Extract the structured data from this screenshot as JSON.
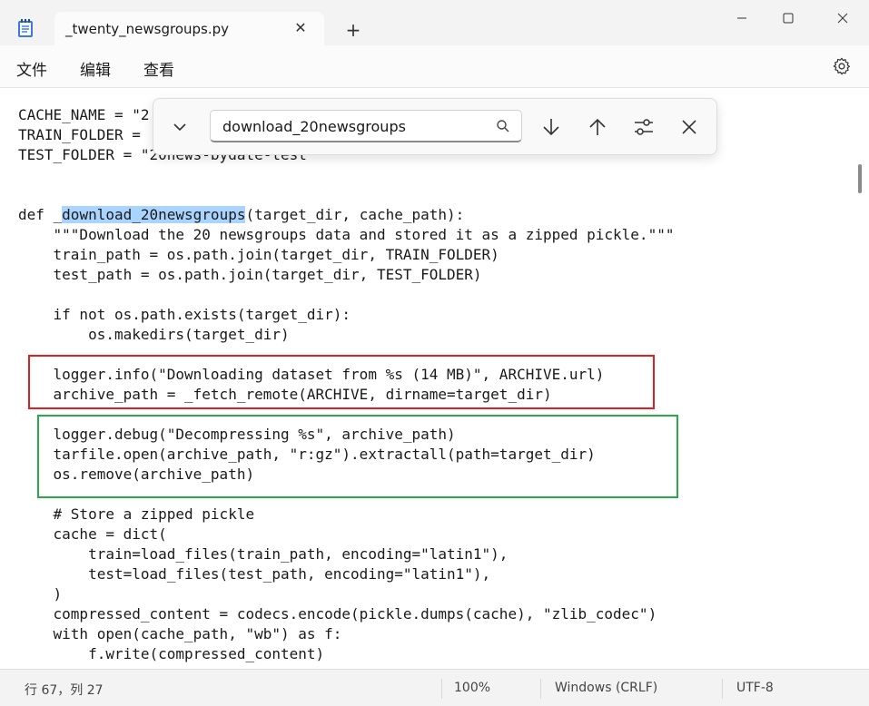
{
  "window": {
    "tab_title": "_twenty_newsgroups.py",
    "tab_close": "✕",
    "new_tab": "+",
    "minimize": "—",
    "maximize": "☐",
    "close": "✕"
  },
  "menu": {
    "items": [
      "文件",
      "编辑",
      "查看"
    ],
    "settings_icon": "gear-icon"
  },
  "find": {
    "query": "download_20newsgroups",
    "icons": [
      "chevron-down-icon",
      "search-icon",
      "arrow-down-icon",
      "arrow-up-icon",
      "options-icon",
      "close-icon"
    ]
  },
  "code": {
    "lines": [
      "CACHE_NAME = \"2",
      "TRAIN_FOLDER = ",
      "TEST_FOLDER = \"20news-bydate-test\"",
      "",
      "",
      "def _",
      "    \"\"\"Download the 20 newsgroups data and stored it as a zipped pickle.\"\"\"",
      "    train_path = os.path.join(target_dir, TRAIN_FOLDER)",
      "    test_path = os.path.join(target_dir, TEST_FOLDER)",
      "",
      "    if not os.path.exists(target_dir):",
      "        os.makedirs(target_dir)",
      "",
      "    logger.info(\"Downloading dataset from %s (14 MB)\", ARCHIVE.url)",
      "    archive_path = _fetch_remote(ARCHIVE, dirname=target_dir)",
      "",
      "    logger.debug(\"Decompressing %s\", archive_path)",
      "    tarfile.open(archive_path, \"r:gz\").extractall(path=target_dir)",
      "    os.remove(archive_path)",
      "",
      "    # Store a zipped pickle",
      "    cache = dict(",
      "        train=load_files(train_path, encoding=\"latin1\"),",
      "        test=load_files(test_path, encoding=\"latin1\"),",
      "    )",
      "    compressed_content = codecs.encode(pickle.dumps(cache), \"zlib_codec\")",
      "    with open(cache_path, \"wb\") as f:",
      "        f.write(compressed_content)"
    ],
    "def_match": "download_20newsgroups",
    "def_rest": "(target_dir, cache_path):",
    "highlight_color": "#a9d4ff",
    "red_box_color": "#e02020",
    "green_box_color": "#2aa84a"
  },
  "status": {
    "position": "行 67，列 27",
    "zoom": "100%",
    "line_ending": "Windows (CRLF)",
    "encoding": "UTF-8"
  }
}
